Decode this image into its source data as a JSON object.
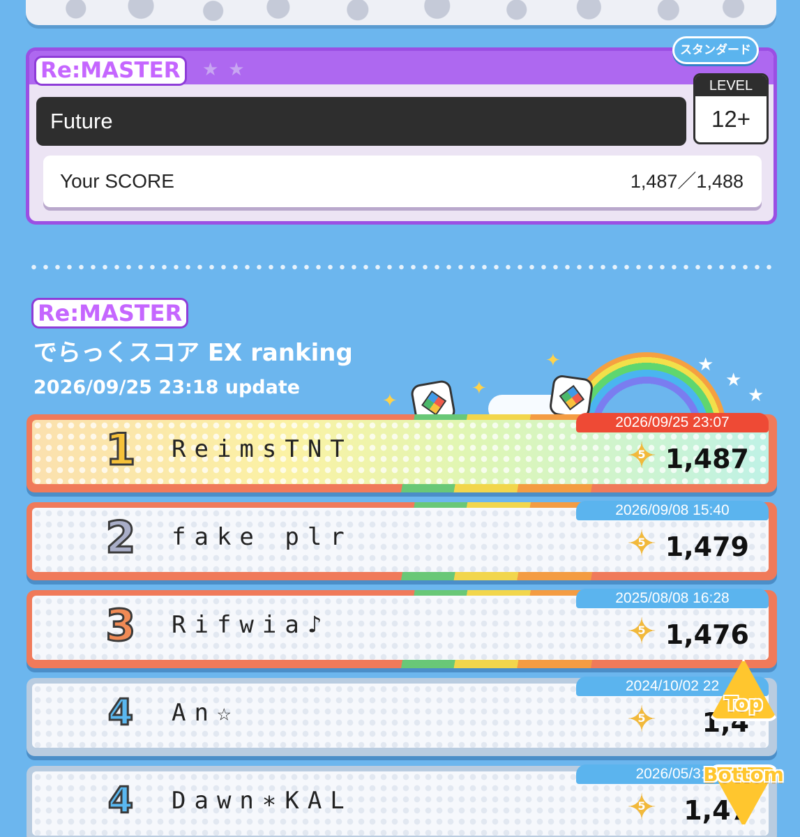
{
  "song": {
    "difficulty": "Re:MASTER",
    "chart_type": "スタンダード",
    "title": "Future",
    "level_label": "LEVEL",
    "level": "12+",
    "score_label": "Your SCORE",
    "score_value": "1,487／1,488"
  },
  "ranking": {
    "difficulty": "Re:MASTER",
    "title": "でらっくスコア EX ranking",
    "updated": "2026/09/25 23:18 update",
    "entries": [
      {
        "rank": "1",
        "name": "ReimsTNT",
        "date": "2026/09/25 23:07",
        "stars": "5",
        "score": "1,487"
      },
      {
        "rank": "2",
        "name": "fake plr",
        "date": "2026/09/08 15:40",
        "stars": "5",
        "score": "1,479"
      },
      {
        "rank": "3",
        "name": "Rifwia♪",
        "date": "2025/08/08 16:28",
        "stars": "5",
        "score": "1,476"
      },
      {
        "rank": "4",
        "name": "An☆",
        "date": "2024/10/02 22",
        "stars": "5",
        "score": "1,4"
      },
      {
        "rank": "4",
        "name": "Dawn∗KAL",
        "date": "2026/05/31",
        "stars": "5",
        "score": "1,47"
      }
    ]
  },
  "nav": {
    "top_label": "Top",
    "bottom_label": "Bottom"
  },
  "colors": {
    "background": "#6cb6ee",
    "remaster_purple": "#9b4fe3",
    "accent_blue": "#5bb4ee",
    "first_place_red": "#ee4a35",
    "nav_yellow": "#ffc62e"
  },
  "icons": {
    "star_rating": "dx-star-icon",
    "nav_up": "triangle-up-icon",
    "nav_down": "triangle-down-icon"
  }
}
